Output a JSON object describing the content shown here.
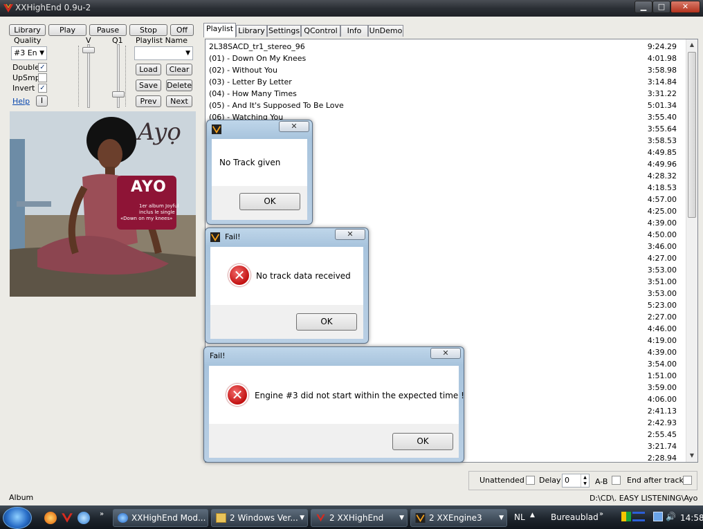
{
  "window": {
    "title": "XXHighEnd 0.9u-2"
  },
  "controls": {
    "library": "Library",
    "play": "Play",
    "pause": "Pause",
    "stop": "Stop",
    "off": "Off",
    "quality_label": "Quality",
    "quality_value": "#3 En",
    "v_label": "V",
    "q1_label": "Q1",
    "double_label": "Double",
    "double_checked": "✓",
    "upsmp_label": "UpSmp",
    "invert_label": "Invert",
    "invert_checked": "✓",
    "help": "Help",
    "info_btn": "I",
    "playlist_name_label": "Playlist Name",
    "load": "Load",
    "clear": "Clear",
    "save": "Save",
    "delete": "Delete",
    "prev": "Prev",
    "next": "Next"
  },
  "album_art": {
    "signature": "Ayọ",
    "badge_title": "AYO",
    "badge_line1": "1er album Joyful",
    "badge_line2": "inclus le single",
    "badge_line3": "«Down on my knees»"
  },
  "tabs": [
    "Playlist",
    "Library",
    "Settings",
    "QControl",
    "Info",
    "UnDemo"
  ],
  "playlist": {
    "rows": [
      {
        "name": "2L38SACD_tr1_stereo_96",
        "dur": "9:24.29"
      },
      {
        "name": "(01) - Down On My Knees",
        "dur": "4:01.98"
      },
      {
        "name": "(02) - Without You",
        "dur": "3:58.98"
      },
      {
        "name": "(03) - Letter By Letter",
        "dur": "3:14.84"
      },
      {
        "name": "(04) - How Many Times",
        "dur": "3:31.22"
      },
      {
        "name": "(05) - And It's Supposed To Be Love",
        "dur": "5:01.34"
      },
      {
        "name": "(06) - Watching You",
        "dur": "3:55.40"
      },
      {
        "name": "",
        "dur": "3:55.64"
      },
      {
        "name": "",
        "dur": "3:58.53"
      },
      {
        "name": "",
        "dur": "4:49.85"
      },
      {
        "name": "",
        "dur": "4:49.96"
      },
      {
        "name": "",
        "dur": "4:28.32"
      },
      {
        "name": "",
        "dur": "4:18.53"
      },
      {
        "name": "",
        "dur": "4:57.00"
      },
      {
        "name": "",
        "dur": "4:25.00"
      },
      {
        "name": "",
        "dur": "4:39.00"
      },
      {
        "name": "",
        "dur": "4:50.00"
      },
      {
        "name": "",
        "dur": "3:46.00"
      },
      {
        "name": "",
        "dur": "4:27.00"
      },
      {
        "name": "",
        "dur": "3:53.00"
      },
      {
        "name": "",
        "dur": "3:51.00"
      },
      {
        "name": "",
        "dur": "3:53.00"
      },
      {
        "name": "",
        "dur": "5:23.00"
      },
      {
        "name": "",
        "dur": "2:27.00"
      },
      {
        "name": "",
        "dur": "4:46.00"
      },
      {
        "name": "",
        "dur": "4:19.00"
      },
      {
        "name": "",
        "dur": "4:39.00"
      },
      {
        "name": "",
        "dur": "3:54.00"
      },
      {
        "name": "",
        "dur": "1:51.00"
      },
      {
        "name": "",
        "dur": "3:59.00"
      },
      {
        "name": "",
        "dur": "4:06.00"
      },
      {
        "name": "",
        "dur": "2:41.13"
      },
      {
        "name": "",
        "dur": "2:42.93"
      },
      {
        "name": "",
        "dur": "2:55.45"
      },
      {
        "name": "",
        "dur": "3:21.74"
      },
      {
        "name": "",
        "dur": "2:28.94"
      }
    ]
  },
  "bottom": {
    "unattended": "Unattended",
    "delay": "Delay",
    "delay_value": "0",
    "ab": "A-B",
    "end_after_track": "End after track",
    "path": "D:\\CD\\. EASY LISTENING\\Ayo",
    "album_label": "Album"
  },
  "dialogs": {
    "d1": {
      "title": "",
      "message": "No Track given",
      "ok": "OK"
    },
    "d2": {
      "title": "Fail!",
      "message": "No track data received",
      "ok": "OK"
    },
    "d3": {
      "title": "Fail!",
      "message": "Engine #3 did not start within the expected time !",
      "ok": "OK"
    }
  },
  "taskbar": {
    "items": [
      {
        "label": "XXHighEnd Mod..."
      },
      {
        "label": "2 Windows Ver..."
      },
      {
        "label": "2 XXHighEnd"
      },
      {
        "label": "2 XXEngine3"
      }
    ],
    "lang": "NL",
    "desktop": "Bureaublad",
    "clock": "14:58"
  },
  "colors": {
    "accent": "#2a6fc9",
    "error": "#c21111",
    "link": "#0645ad"
  }
}
